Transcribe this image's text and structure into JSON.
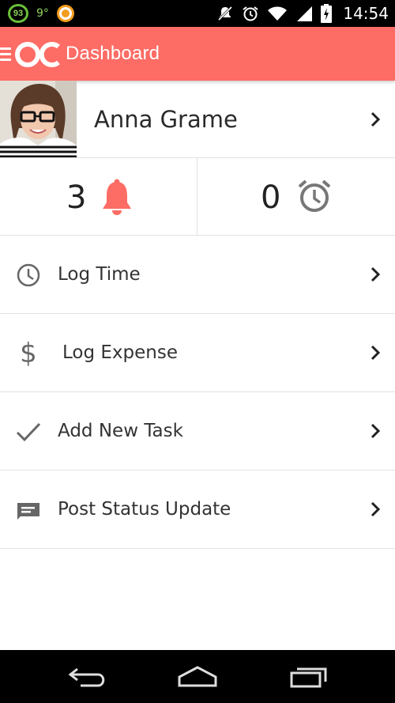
{
  "status_bar": {
    "notification_badge": "93",
    "temperature": "9°",
    "time": "14:54",
    "icons": [
      "battery-saver-badge",
      "orange-app-icon",
      "mute-icon",
      "alarm-icon",
      "wifi-icon",
      "signal-icon",
      "battery-icon"
    ]
  },
  "app_bar": {
    "title": "Dashboard",
    "logo_icon": "oc-logo",
    "menu_icon": "hamburger-icon",
    "background_color": "#fd6c65"
  },
  "profile": {
    "name": "Anna Grame",
    "chevron_icon": "chevron-right-icon"
  },
  "counters": {
    "notifications": {
      "count": "3",
      "icon": "bell-icon",
      "color": "#fd6c65"
    },
    "alarms": {
      "count": "0",
      "icon": "alarm-clock-icon",
      "color": "#777777"
    }
  },
  "menu": [
    {
      "label": "Log Time",
      "icon": "clock-icon"
    },
    {
      "label": "Log Expense",
      "icon": "dollar-icon"
    },
    {
      "label": "Add New Task",
      "icon": "check-icon"
    },
    {
      "label": "Post Status Update",
      "icon": "message-icon"
    }
  ],
  "nav_bar": {
    "buttons": [
      "back-icon",
      "home-icon",
      "recents-icon"
    ]
  }
}
